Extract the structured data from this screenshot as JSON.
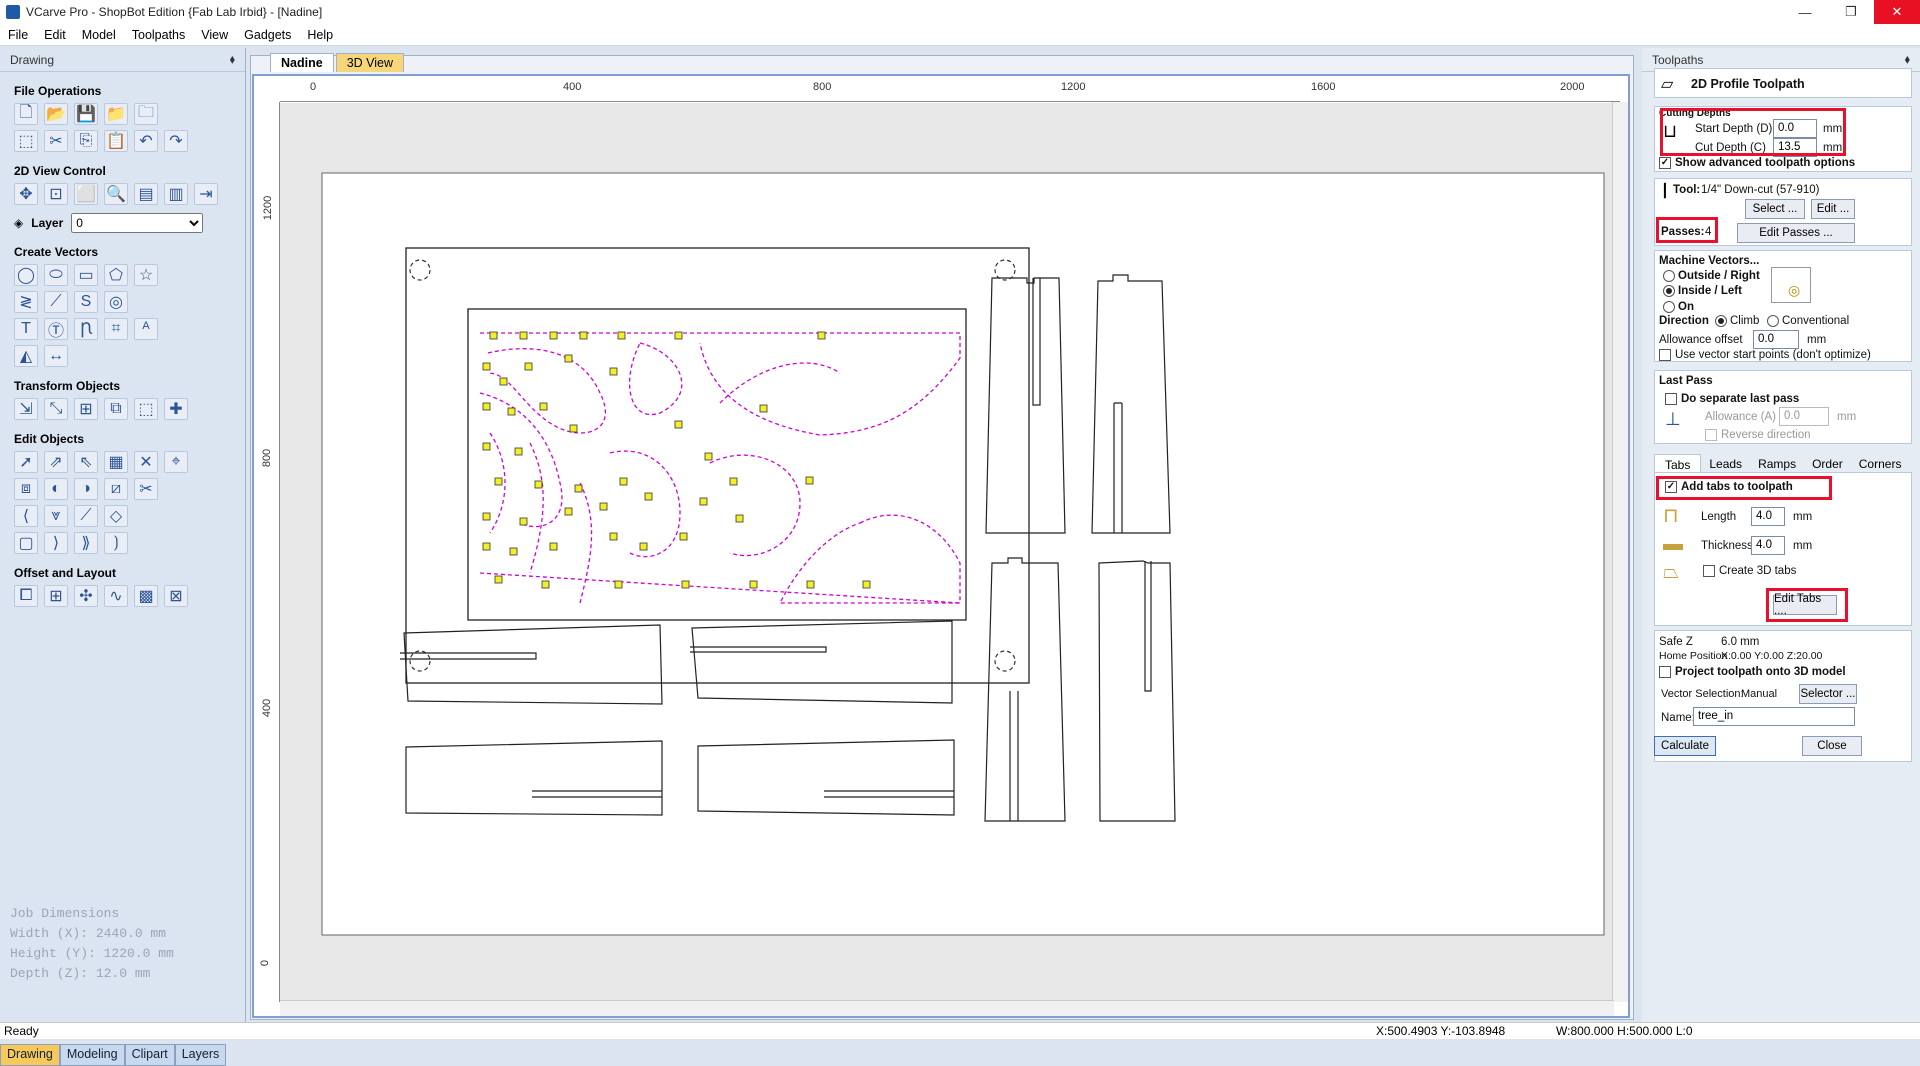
{
  "window": {
    "title": "VCarve Pro - ShopBot Edition {Fab Lab Irbid} - [Nadine]",
    "min": "—",
    "restore": "❐",
    "close": "✕"
  },
  "menu": [
    "File",
    "Edit",
    "Model",
    "Toolpaths",
    "View",
    "Gadgets",
    "Help"
  ],
  "left_panel": {
    "title": "Drawing",
    "pin": "⬧",
    "sections": {
      "file_ops": "File Operations",
      "view_control": "2D View Control",
      "create_vectors": "Create Vectors",
      "transform": "Transform Objects",
      "edit": "Edit Objects",
      "offset": "Offset and Layout"
    },
    "layer_label": "Layer",
    "layer_value": "0",
    "job_dims": {
      "title": "Job Dimensions",
      "width": "Width  (X): 2440.0 mm",
      "height": "Height (Y): 1220.0 mm",
      "depth": "Depth  (Z): 12.0 mm"
    },
    "tabs": [
      "Drawing",
      "Modeling",
      "Clipart",
      "Layers"
    ]
  },
  "doc_tabs": [
    "Nadine",
    "3D View"
  ],
  "ruler": {
    "h": [
      "0",
      "400",
      "800",
      "1200",
      "1600",
      "2000"
    ],
    "v": [
      "1200",
      "800",
      "400",
      "0"
    ]
  },
  "status": {
    "left": "Ready",
    "coords": "X:500.4903 Y:-103.8948",
    "size": "W:800.000  H:500.000  L:0"
  },
  "right_panel": {
    "title": "Toolpaths",
    "pin": "⬧",
    "header": "2D Profile Toolpath",
    "cutting_depths": "Cutting Depths",
    "start_depth_label": "Start Depth (D)",
    "start_depth": "0.0",
    "cut_depth_label": "Cut Depth (C)",
    "cut_depth": "13.5",
    "unit": "mm",
    "show_advanced": "Show advanced toolpath options",
    "tool_label": "Tool:",
    "tool_value": "1/4\" Down-cut (57-910)",
    "select_btn": "Select ...",
    "edit_btn": "Edit ...",
    "passes_label": "Passes:",
    "passes_value": "4",
    "edit_passes_btn": "Edit Passes ...",
    "machine_vectors": "Machine Vectors...",
    "outside": "Outside / Right",
    "inside": "Inside / Left",
    "on": "On",
    "direction": "Direction",
    "climb": "Climb",
    "conventional": "Conventional",
    "allowance_label": "Allowance offset",
    "allowance_value": "0.0",
    "use_vector_start": "Use vector start points (don't optimize)",
    "last_pass": "Last Pass",
    "separate_last": "Do separate last pass",
    "allowance_a": "Allowance (A)",
    "allowance_a_value": "0.0",
    "reverse_dir": "Reverse direction",
    "subtabs": [
      "Tabs",
      "Leads",
      "Ramps",
      "Order",
      "Corners"
    ],
    "add_tabs": "Add tabs to toolpath",
    "length_label": "Length",
    "length_value": "4.0",
    "thickness_label": "Thickness",
    "thickness_value": "4.0",
    "create_3d_tabs": "Create 3D tabs",
    "edit_tabs_btn": "Edit Tabs ....",
    "safe_z_label": "Safe Z",
    "safe_z_value": "6.0 mm",
    "home_label": "Home Position",
    "home_value": "X:0.00 Y:0.00 Z:20.00",
    "project_3d": "Project toolpath onto 3D model",
    "vector_sel_label": "Vector Selection:",
    "vector_sel_value": "Manual",
    "selector_btn": "Selector ...",
    "name_label": "Name:",
    "name_value": "tree_in",
    "calculate_btn": "Calculate",
    "close_btn": "Close"
  }
}
